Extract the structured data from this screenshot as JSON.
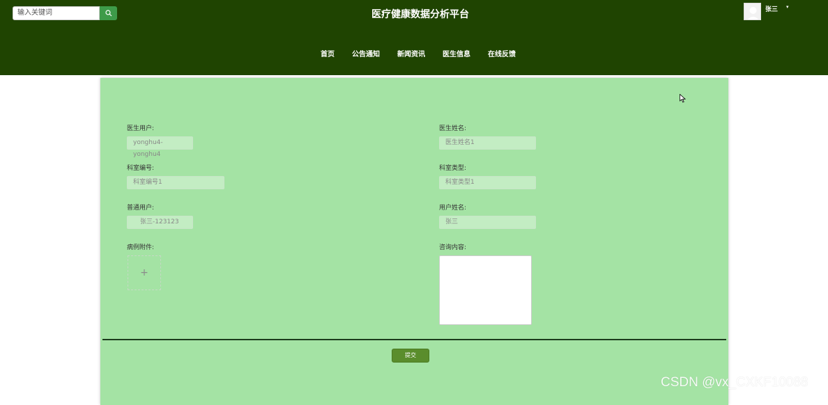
{
  "header": {
    "search_placeholder": "输入关键词",
    "site_title": "医疗健康数据分析平台",
    "user_name": "张三",
    "user_caret": "▾",
    "background_color": "#1f4401"
  },
  "nav": {
    "items": [
      {
        "label": "首页"
      },
      {
        "label": "公告通知"
      },
      {
        "label": "新闻资讯"
      },
      {
        "label": "医生信息"
      },
      {
        "label": "在线反馈"
      }
    ]
  },
  "form": {
    "doctor_user": {
      "label": "医生用户:",
      "value": "yonghu4-yonghu4"
    },
    "doctor_name": {
      "label": "医生姓名:",
      "value": "医生姓名1"
    },
    "dept_code": {
      "label": "科室编号:",
      "value": "科室编号1"
    },
    "dept_type": {
      "label": "科室类型:",
      "value": "科室类型1"
    },
    "normal_user": {
      "label": "普通用户:",
      "value": "张三-123123"
    },
    "user_name": {
      "label": "用户姓名:",
      "value": "张三"
    },
    "attachment": {
      "label": "病例附件:",
      "upload_glyph": "+"
    },
    "consult": {
      "label": "咨询内容:",
      "value": ""
    },
    "submit_label": "提交",
    "panel_color": "#a4e3a4"
  },
  "watermark": "CSDN @vx_CXKF10088"
}
